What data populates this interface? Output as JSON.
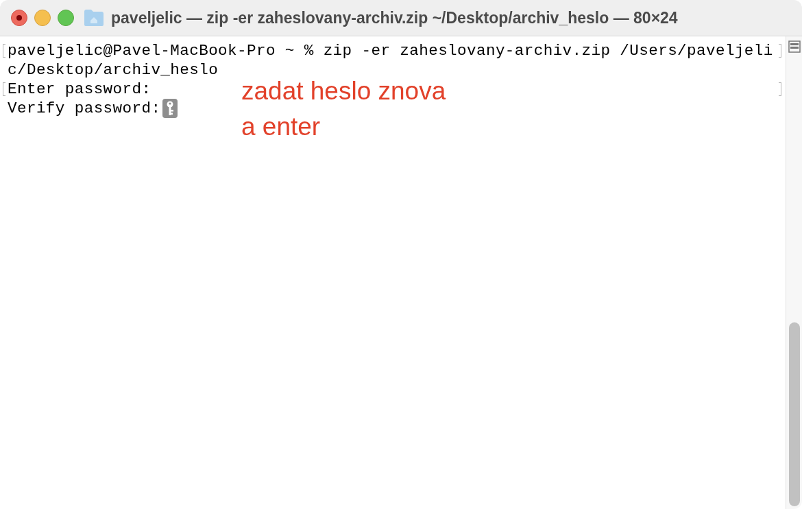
{
  "window": {
    "title": "paveljelic — zip -er zaheslovany-archiv.zip ~/Desktop/archiv_heslo — 80×24"
  },
  "terminal": {
    "lines": [
      {
        "text": "paveljelic@Pavel-MacBook-Pro ~ % zip -er zaheslovany-archiv.zip /Users/paveljeli",
        "marked": true,
        "kind": "text"
      },
      {
        "text": "c/Desktop/archiv_heslo",
        "marked": false,
        "kind": "text"
      },
      {
        "text": "Enter password:",
        "marked": true,
        "kind": "text"
      },
      {
        "text": "Verify password:",
        "marked": false,
        "kind": "password-prompt"
      }
    ]
  },
  "annotation": {
    "lines": [
      "zadat heslo znova",
      "a enter"
    ]
  }
}
